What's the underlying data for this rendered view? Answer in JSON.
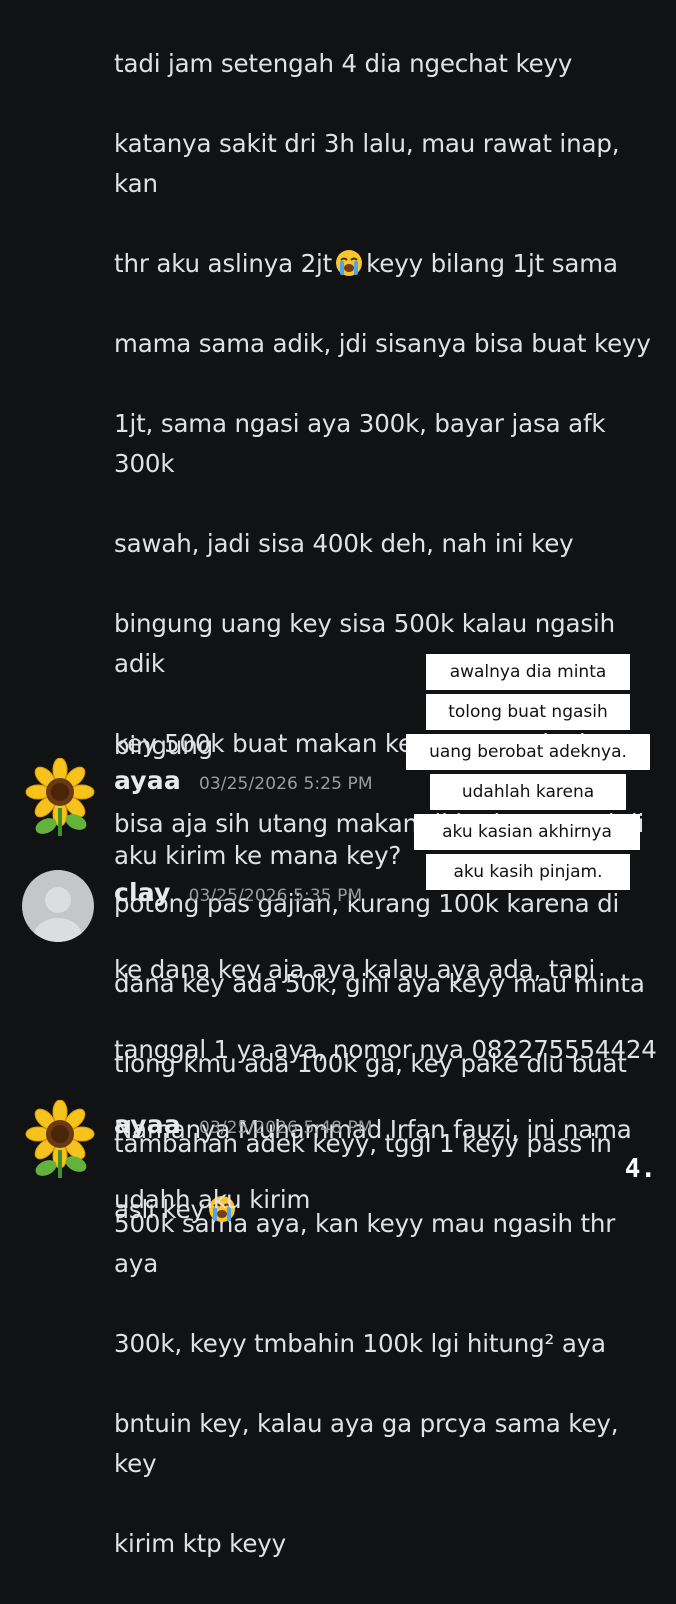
{
  "messages": {
    "first": {
      "lines": [
        "tadi jam setengah 4 dia ngechat keyy",
        "katanya sakit dri 3h lalu, mau rawat inap, kan",
        "thr aku aslinya 2jt",
        "keyy bilang 1jt sama",
        "mama sama adik, jdi sisanya bisa buat keyy",
        "1jt, sama ngasi aya 300k, bayar jasa afk 300k",
        "sawah, jadi sisa 400k deh, nah ini key",
        "bingung uang key sisa 500k kalau ngasih adik",
        "key 500k buat makan key engga ada, key",
        "bisa aja sih utang makan di kerjaan nanti di",
        "potong pas gajian, kurang 100k karena di",
        "dana key ada 50k, gini aya keyy mau minta",
        "tlong kmu ada 100k ga, key pake dlu buat",
        "tambahan adek keyy, tggl 1 keyy pass in",
        "500k sama aya, kan keyy mau ngasih thr aya",
        "300k, keyy tmbahin 100k lgi hitung² aya",
        "bntuin key, kalau aya ga prcya sama key, key",
        "kirim ktp keyy"
      ],
      "second": "bingung"
    },
    "ayaa1": {
      "author": "ayaa",
      "time": "03/25/2026 5:25 PM",
      "text": "aku kirim ke mana key?"
    },
    "clay": {
      "author": "clay",
      "time": "03/25/2026 5:35 PM",
      "lines": [
        "ke dana key aja aya kalau aya ada, tapi",
        "tanggal 1 ya aya, nomor nya 082275554424",
        "Namanya Muhammad Irfan fauzi, ini nama",
        "asli key"
      ]
    },
    "ayaa2": {
      "author": "ayaa",
      "time": "03/25/2026 5:48 PM",
      "text": "udahh aku kirim"
    }
  },
  "annotation": {
    "lines": [
      "awalnya dia minta",
      "tolong buat ngasih",
      "uang berobat adeknya.",
      "udahlah karena",
      "aku kasian akhirnya",
      "aku kasih pinjam."
    ]
  },
  "page_number": "4.",
  "colors": {
    "background": "#111214",
    "text": "#e0e1e4",
    "timestamp": "#9a9ca1"
  }
}
